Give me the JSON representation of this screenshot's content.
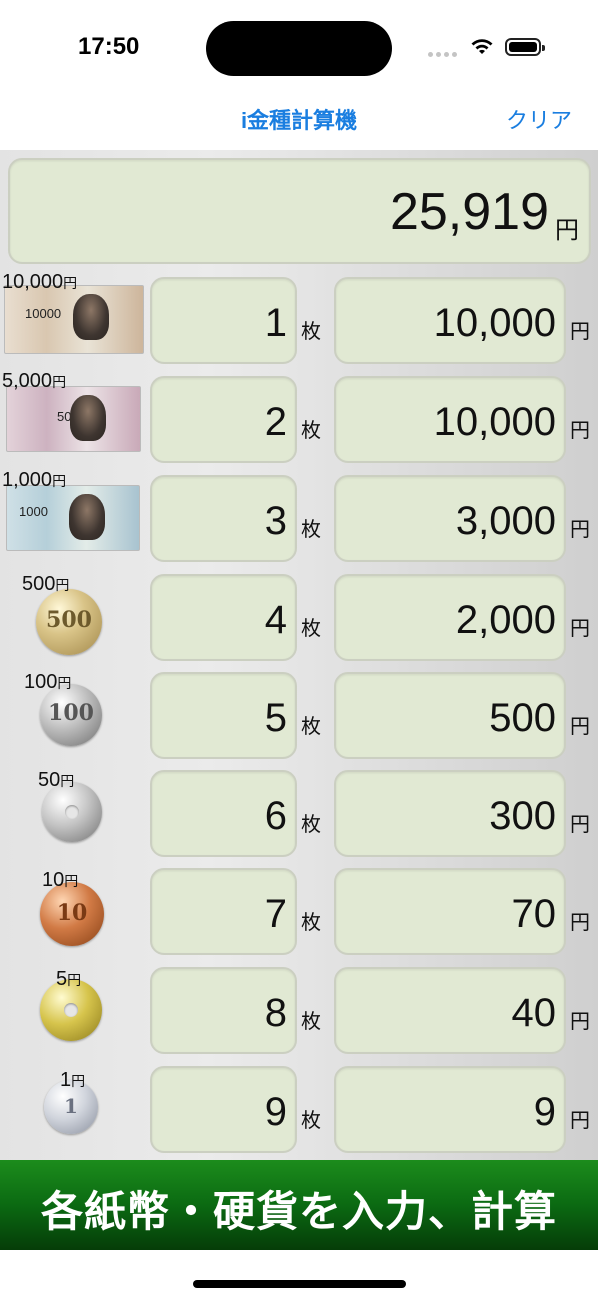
{
  "status": {
    "time": "17:50"
  },
  "nav": {
    "title": "i金種計算機",
    "clear_label": "クリア"
  },
  "total": {
    "value": "25,919",
    "unit": "円"
  },
  "units": {
    "count": "枚",
    "yen": "円"
  },
  "rows": [
    {
      "label_num": "10,000",
      "label_unit": "円",
      "count": "1",
      "amount": "10,000",
      "bill_text": "10000"
    },
    {
      "label_num": "5,000",
      "label_unit": "円",
      "count": "2",
      "amount": "10,000",
      "bill_text": "5000"
    },
    {
      "label_num": "1,000",
      "label_unit": "円",
      "count": "3",
      "amount": "3,000",
      "bill_text": "1000"
    },
    {
      "label_num": "500",
      "label_unit": "円",
      "count": "4",
      "amount": "2,000",
      "coin_text": "500"
    },
    {
      "label_num": "100",
      "label_unit": "円",
      "count": "5",
      "amount": "500",
      "coin_text": "100"
    },
    {
      "label_num": "50",
      "label_unit": "円",
      "count": "6",
      "amount": "300"
    },
    {
      "label_num": "10",
      "label_unit": "円",
      "count": "7",
      "amount": "70",
      "coin_text": "10"
    },
    {
      "label_num": "5",
      "label_unit": "円",
      "count": "8",
      "amount": "40"
    },
    {
      "label_num": "1",
      "label_unit": "円",
      "count": "9",
      "amount": "9",
      "coin_text": "1"
    }
  ],
  "banner": {
    "text": "各紙幣・硬貨を入力、計算"
  },
  "icons": {
    "wifi": "wifi-icon",
    "battery": "battery-icon",
    "signal": "cellular-signal-icon"
  },
  "colors": {
    "accent": "#1a7ee0",
    "field_bg": "#e1e9d3",
    "banner_green": "#0b6a12"
  }
}
